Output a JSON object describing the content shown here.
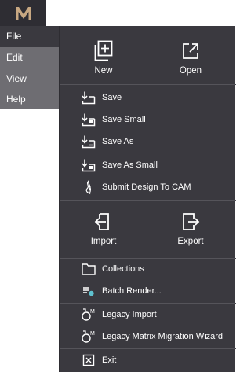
{
  "app": {
    "logo_icon": "m-logo-icon",
    "accent": "#c8a882",
    "menubar_bg": "#6e6d72",
    "panel_bg": "#3a393f"
  },
  "menubar": {
    "items": [
      {
        "label": "File"
      },
      {
        "label": "Edit"
      },
      {
        "label": "View"
      },
      {
        "label": "Help"
      }
    ]
  },
  "file_menu": {
    "new_label": "New",
    "open_label": "Open",
    "save_label": "Save",
    "save_small_label": "Save Small",
    "save_as_label": "Save As",
    "save_as_small_label": "Save As Small",
    "submit_cam_label": "Submit Design To CAM",
    "import_label": "Import",
    "export_label": "Export",
    "collections_label": "Collections",
    "batch_render_label": "Batch Render...",
    "legacy_import_label": "Legacy Import",
    "legacy_wizard_label": "Legacy Matrix Migration Wizard",
    "exit_label": "Exit"
  }
}
